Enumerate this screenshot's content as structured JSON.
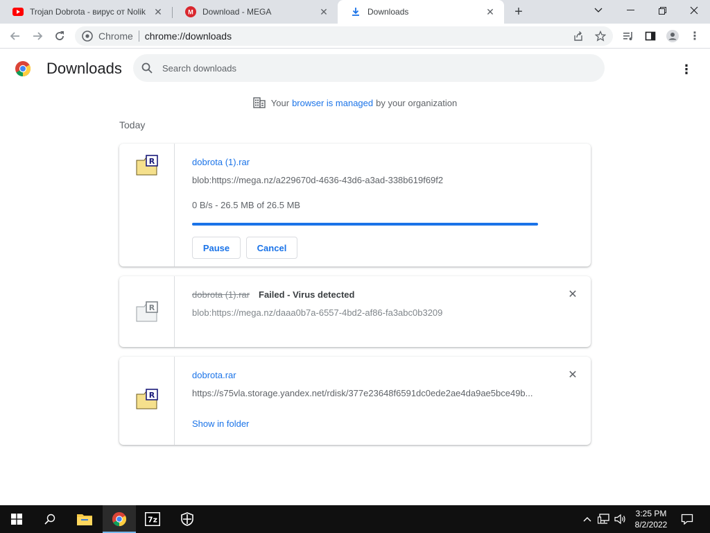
{
  "tabs": [
    {
      "title": "Trojan Dobrota - вирус от Nolik",
      "favicon": "youtube-icon",
      "active": false
    },
    {
      "title": "Download - MEGA",
      "favicon": "mega-icon",
      "active": false
    },
    {
      "title": "Downloads",
      "favicon": "download-icon",
      "active": true
    }
  ],
  "toolbar": {
    "site_label": "Chrome",
    "url": "chrome://downloads"
  },
  "page": {
    "title": "Downloads",
    "search_placeholder": "Search downloads"
  },
  "managed": {
    "prefix": "Your",
    "link": "browser is managed",
    "suffix": "by your organization"
  },
  "section": "Today",
  "downloads": [
    {
      "name": "dobrota (1).rar",
      "url": "blob:https://mega.nz/a229670d-4636-43d6-a3ad-338b619f69f2",
      "status": "0 B/s - 26.5 MB of 26.5 MB",
      "progress": 1.0,
      "pause_label": "Pause",
      "cancel_label": "Cancel"
    },
    {
      "name": "dobrota (1).rar",
      "description": "Failed - Virus detected",
      "url": "blob:https://mega.nz/daaa0b7a-6557-4bd2-af86-fa3abc0b3209"
    },
    {
      "name": "dobrota.rar",
      "url": "https://s75vla.storage.yandex.net/rdisk/377e23648f6591dc0ede2ae4da9ae5bce49b...",
      "link_label": "Show in folder"
    }
  ],
  "taskbar": {
    "time": "3:25 PM",
    "date": "8/2/2022",
    "apps": [
      "file-explorer-icon",
      "chrome-icon",
      "7zip-icon",
      "windows-security-icon"
    ]
  },
  "colors": {
    "accent": "#1a73e8",
    "tabstrip": "#dee1e6",
    "taskbar": "#101010"
  }
}
